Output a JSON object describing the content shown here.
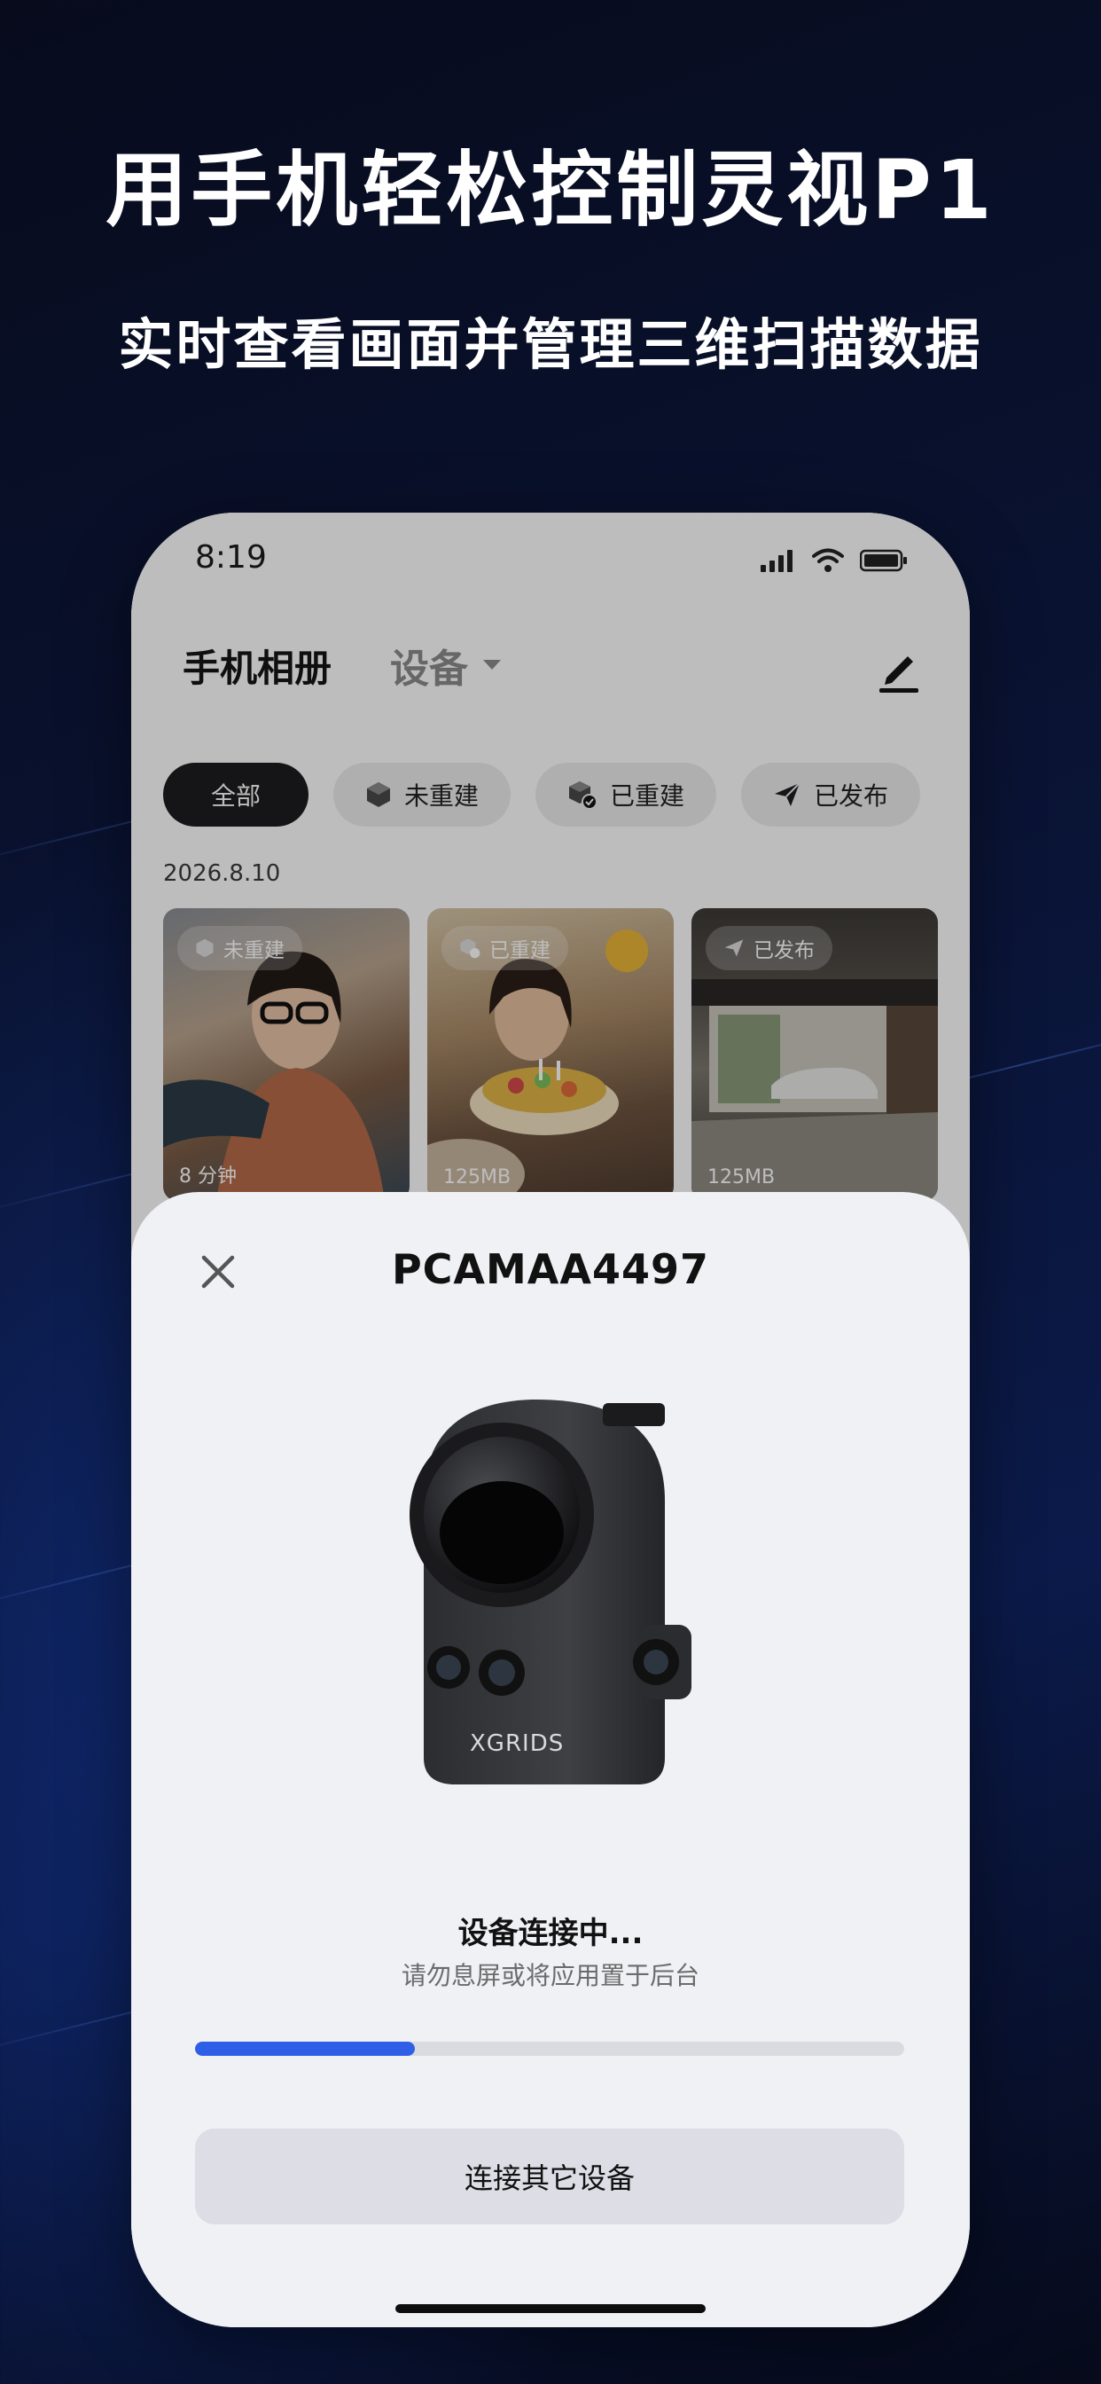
{
  "hero": {
    "title": "用手机轻松控制灵视P1",
    "subtitle": "实时查看画面并管理三维扫描数据"
  },
  "status_bar": {
    "time": "8:19",
    "icons": [
      "signal-icon",
      "wifi-icon",
      "battery-icon"
    ]
  },
  "header": {
    "tab_active": "手机相册",
    "tab_inactive": "设备",
    "edit_icon": "edit-pen-icon"
  },
  "filters": [
    {
      "label": "全部",
      "active": true
    },
    {
      "label": "未重建",
      "icon": "cube-icon"
    },
    {
      "label": "已重建",
      "icon": "cube-check-icon"
    },
    {
      "label": "已发布",
      "icon": "send-icon"
    }
  ],
  "gallery": {
    "date": "2026.8.10",
    "items": [
      {
        "badge": "未重建",
        "meta": "8 分钟"
      },
      {
        "badge": "已重建",
        "meta": "125MB"
      },
      {
        "badge": "已发布",
        "meta": "125MB"
      }
    ]
  },
  "sheet": {
    "device_name": "PCAMAA4497",
    "brand": "XGRIDS",
    "status_title": "设备连接中...",
    "status_hint": "请勿息屏或将应用置于后台",
    "progress": 0.31,
    "button_label": "连接其它设备"
  },
  "colors": {
    "accent": "#2f5fe6",
    "background": "#0a1436",
    "sheet": "#f0f1f5"
  }
}
